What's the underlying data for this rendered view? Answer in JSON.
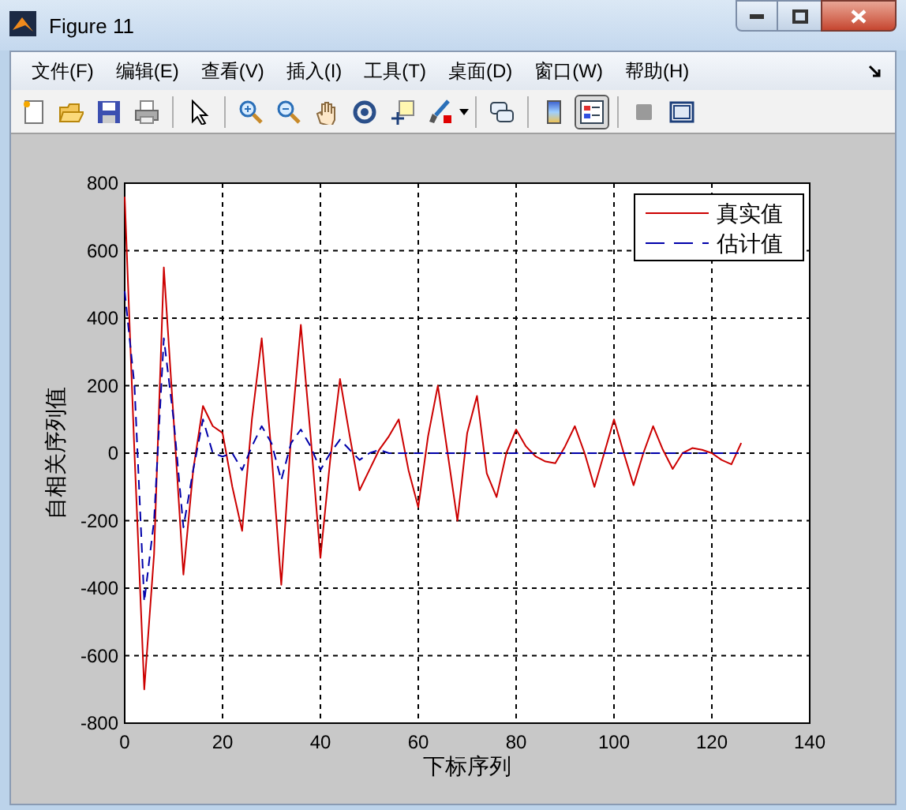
{
  "window": {
    "title": "Figure 11"
  },
  "menu": [
    "文件(F)",
    "编辑(E)",
    "查看(V)",
    "插入(I)",
    "工具(T)",
    "桌面(D)",
    "窗口(W)",
    "帮助(H)"
  ],
  "toolbar": [
    [
      {
        "selected": false
      },
      {
        "selected": false
      },
      {
        "selected": false
      },
      {
        "selected": false
      }
    ],
    [
      {
        "selected": false
      }
    ],
    [
      {
        "selected": false
      },
      {
        "selected": false
      },
      {
        "selected": false
      },
      {
        "selected": false
      },
      {
        "selected": false
      },
      {
        "selected": false
      }
    ],
    [
      {
        "selected": false
      }
    ],
    [
      {
        "selected": false
      },
      {
        "selected": true
      }
    ],
    [
      {
        "selected": false
      },
      {
        "selected": false
      }
    ]
  ],
  "figure": {
    "chart_data": {
      "type": "line",
      "xlabel": "下标序列",
      "ylabel": "自相关序列值",
      "x": [
        0,
        2,
        4,
        6,
        8,
        10,
        12,
        14,
        16,
        18,
        20,
        22,
        24,
        26,
        28,
        30,
        32,
        34,
        36,
        38,
        40,
        42,
        44,
        46,
        48,
        50,
        52,
        54,
        56,
        58,
        60,
        62,
        64,
        66,
        68,
        70,
        72,
        74,
        76,
        78,
        80,
        82,
        84,
        86,
        88,
        90,
        92,
        94,
        96,
        98,
        100,
        102,
        104,
        106,
        108,
        110,
        112,
        114,
        116,
        118,
        120,
        122,
        124,
        126
      ],
      "series": [
        {
          "name": "真实值",
          "color": "#cc0000",
          "line_style": "solid",
          "values": [
            760,
            0,
            -700,
            -300,
            550,
            100,
            -360,
            -50,
            140,
            80,
            60,
            -100,
            -230,
            100,
            340,
            0,
            -390,
            50,
            380,
            50,
            -310,
            -20,
            220,
            50,
            -110,
            -50,
            10,
            50,
            100,
            -50,
            -160,
            50,
            200,
            0,
            -200,
            60,
            170,
            -60,
            -130,
            0,
            70,
            20,
            -10,
            -25,
            -30,
            20,
            80,
            0,
            -100,
            0,
            100,
            0,
            -95,
            0,
            80,
            10,
            -47,
            0,
            15,
            10,
            0,
            -20,
            -33,
            30
          ]
        },
        {
          "name": "估计值",
          "color": "#0000aa",
          "line_style": "dashed",
          "values": [
            480,
            200,
            -440,
            -200,
            340,
            100,
            -220,
            -50,
            100,
            0,
            -10,
            0,
            -50,
            20,
            80,
            30,
            -80,
            30,
            70,
            20,
            -50,
            0,
            40,
            10,
            -20,
            0,
            10,
            0,
            0,
            0,
            0,
            0,
            0,
            0,
            0,
            0,
            0,
            0,
            0,
            0,
            0,
            0,
            0,
            0,
            0,
            0,
            0,
            0,
            0,
            0,
            0,
            0,
            0,
            0,
            0,
            0,
            0,
            0,
            0,
            0,
            0,
            0,
            0,
            0
          ]
        }
      ],
      "grid": true,
      "legend": true,
      "xlim": [
        0,
        140
      ],
      "ylim": [
        -800,
        800
      ],
      "xticks": [
        0,
        20,
        40,
        60,
        80,
        100,
        120,
        140
      ],
      "yticks": [
        -800,
        -600,
        -400,
        -200,
        0,
        200,
        400,
        600,
        800
      ]
    }
  }
}
